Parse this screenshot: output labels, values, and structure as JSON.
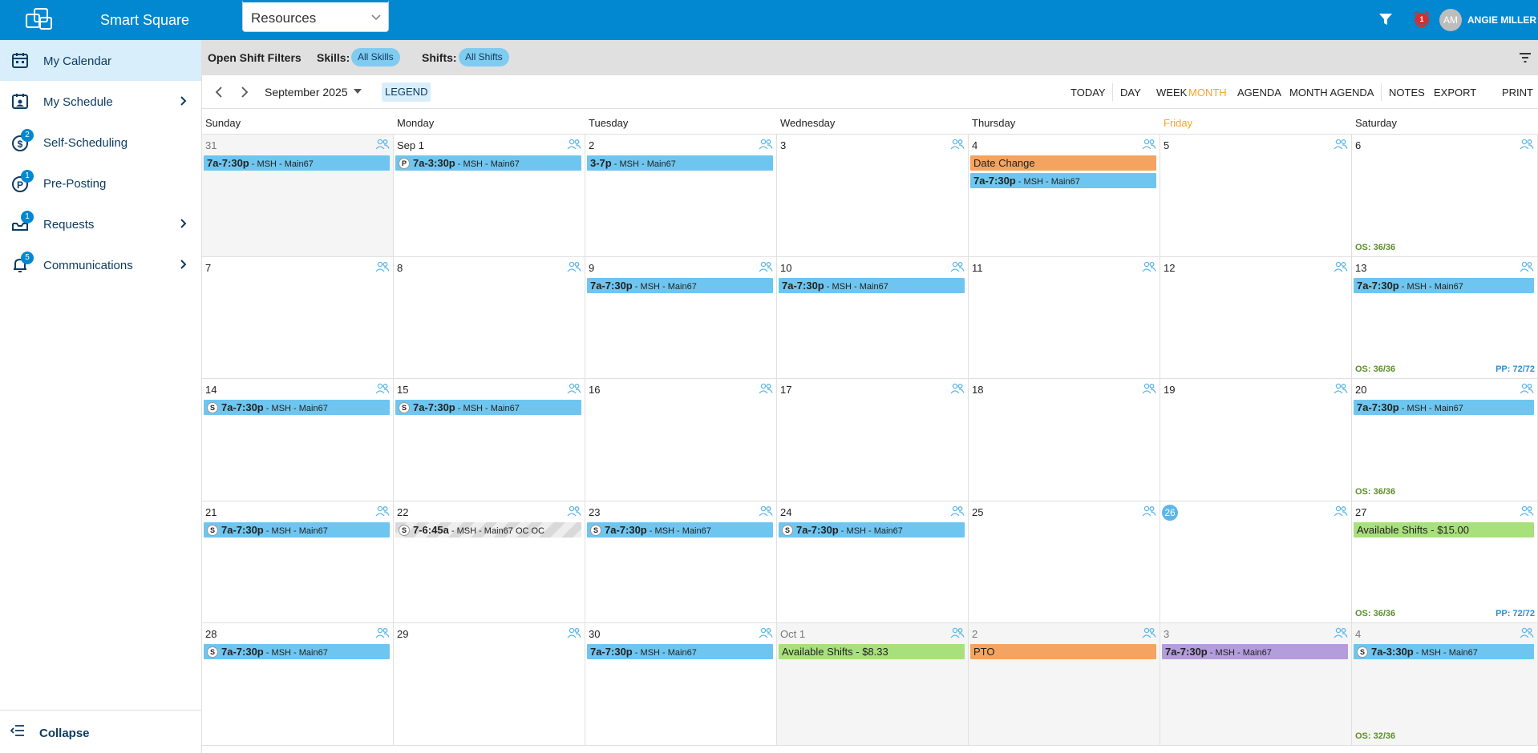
{
  "app": {
    "title": "Smart Square",
    "resources_label": "Resources"
  },
  "user": {
    "initials": "AM",
    "name": "ANGIE MILLER",
    "alarm_count": "1"
  },
  "sidebar": {
    "items": [
      {
        "label": "My Calendar",
        "icon": "calendar-icon",
        "active": true
      },
      {
        "label": "My Schedule",
        "icon": "schedule-icon"
      },
      {
        "label": "Self-Scheduling",
        "icon": "dollar-icon",
        "badge": "2"
      },
      {
        "label": "Pre-Posting",
        "icon": "p-circle-icon",
        "badge": "1"
      },
      {
        "label": "Requests",
        "icon": "inbox-icon",
        "badge": "1"
      },
      {
        "label": "Communications",
        "icon": "bell-icon",
        "badge": "5"
      }
    ],
    "collapse_label": "Collapse"
  },
  "filters": {
    "title": "Open Shift Filters",
    "skills_label": "Skills:",
    "skills_value": "All Skills",
    "shifts_label": "Shifts:",
    "shifts_value": "All Shifts"
  },
  "toolbar": {
    "month": "September 2025",
    "legend": "LEGEND",
    "views": [
      "TODAY",
      "DAY",
      "WEEK",
      "MONTH",
      "AGENDA",
      "MONTH AGENDA",
      "NOTES",
      "EXPORT",
      "PRINT"
    ],
    "active_view": "MONTH"
  },
  "calendar": {
    "day_headers": [
      "Sunday",
      "Monday",
      "Tuesday",
      "Wednesday",
      "Thursday",
      "Friday",
      "Saturday"
    ],
    "today_header_index": 5,
    "weeks": [
      [
        {
          "label": "31",
          "out": true,
          "events": [
            {
              "time": "7a-7:30p",
              "sub": " - MSH - Main67",
              "color": "blue"
            }
          ]
        },
        {
          "label": "Sep 1",
          "events": [
            {
              "badge": "P",
              "time": "7a-3:30p",
              "sub": " - MSH - Main67",
              "color": "blue"
            }
          ]
        },
        {
          "label": "2",
          "events": [
            {
              "time": "3-7p",
              "sub": " - MSH - Main67",
              "color": "blue"
            }
          ]
        },
        {
          "label": "3",
          "events": []
        },
        {
          "label": "4",
          "events": [
            {
              "text": "Date Change",
              "color": "orange"
            },
            {
              "time": "7a-7:30p",
              "sub": " - MSH - Main67",
              "color": "blue"
            }
          ]
        },
        {
          "label": "5",
          "events": []
        },
        {
          "label": "6",
          "events": [],
          "os": "OS: 36/36"
        }
      ],
      [
        {
          "label": "7",
          "events": []
        },
        {
          "label": "8",
          "events": []
        },
        {
          "label": "9",
          "events": [
            {
              "time": "7a-7:30p",
              "sub": " - MSH - Main67",
              "color": "blue"
            }
          ]
        },
        {
          "label": "10",
          "events": [
            {
              "time": "7a-7:30p",
              "sub": " - MSH - Main67",
              "color": "blue"
            }
          ]
        },
        {
          "label": "11",
          "events": []
        },
        {
          "label": "12",
          "events": []
        },
        {
          "label": "13",
          "events": [
            {
              "time": "7a-7:30p",
              "sub": " - MSH - Main67",
              "color": "blue"
            }
          ],
          "os": "OS: 36/36",
          "pp": "PP: 72/72"
        }
      ],
      [
        {
          "label": "14",
          "events": [
            {
              "badge": "S",
              "time": "7a-7:30p",
              "sub": " - MSH - Main67",
              "color": "blue"
            }
          ]
        },
        {
          "label": "15",
          "events": [
            {
              "badge": "S",
              "time": "7a-7:30p",
              "sub": " - MSH - Main67",
              "color": "blue"
            }
          ]
        },
        {
          "label": "16",
          "events": []
        },
        {
          "label": "17",
          "events": []
        },
        {
          "label": "18",
          "events": []
        },
        {
          "label": "19",
          "events": []
        },
        {
          "label": "20",
          "events": [
            {
              "time": "7a-7:30p",
              "sub": " - MSH - Main67",
              "color": "blue"
            }
          ],
          "os": "OS: 36/36"
        }
      ],
      [
        {
          "label": "21",
          "events": [
            {
              "badge": "S",
              "time": "7a-7:30p",
              "sub": " - MSH - Main67",
              "color": "blue"
            }
          ]
        },
        {
          "label": "22",
          "events": [
            {
              "badge": "S",
              "time": "7-6:45a",
              "sub": " - MSH - Main67 OC OC",
              "color": "gray"
            }
          ]
        },
        {
          "label": "23",
          "events": [
            {
              "badge": "S",
              "time": "7a-7:30p",
              "sub": " - MSH - Main67",
              "color": "blue"
            }
          ]
        },
        {
          "label": "24",
          "events": [
            {
              "badge": "S",
              "time": "7a-7:30p",
              "sub": " - MSH - Main67",
              "color": "blue"
            }
          ]
        },
        {
          "label": "25",
          "events": []
        },
        {
          "label": "26",
          "today": true,
          "events": []
        },
        {
          "label": "27",
          "events": [
            {
              "text": "Available Shifts - $15.00",
              "color": "green"
            }
          ],
          "os": "OS: 36/36",
          "pp": "PP: 72/72"
        }
      ],
      [
        {
          "label": "28",
          "events": [
            {
              "badge": "S",
              "time": "7a-7:30p",
              "sub": " - MSH - Main67",
              "color": "blue"
            }
          ]
        },
        {
          "label": "29",
          "events": []
        },
        {
          "label": "30",
          "events": [
            {
              "time": "7a-7:30p",
              "sub": " - MSH - Main67",
              "color": "blue"
            }
          ]
        },
        {
          "label": "Oct 1",
          "out": true,
          "events": [
            {
              "text": "Available Shifts - $8.33",
              "color": "green"
            }
          ]
        },
        {
          "label": "2",
          "out": true,
          "events": [
            {
              "text": "PTO",
              "color": "orange"
            }
          ]
        },
        {
          "label": "3",
          "out": true,
          "events": [
            {
              "time": "7a-7:30p",
              "sub": " - MSH - Main67",
              "color": "purple"
            }
          ]
        },
        {
          "label": "4",
          "out": true,
          "events": [
            {
              "badge": "S",
              "time": "7a-3:30p",
              "sub": " - MSH - Main67",
              "color": "blue"
            }
          ],
          "os": "OS: 32/36"
        }
      ]
    ]
  }
}
